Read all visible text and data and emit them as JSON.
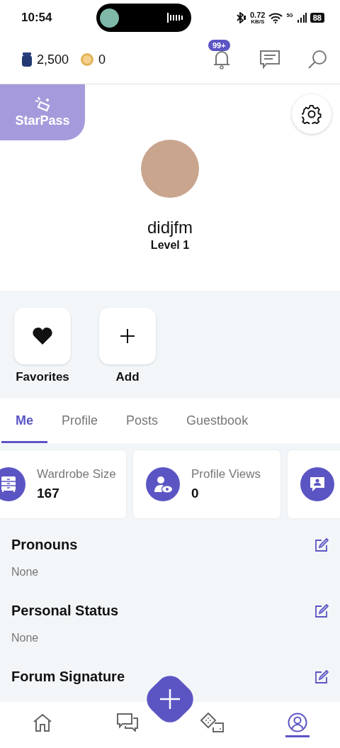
{
  "status_bar": {
    "time": "10:54",
    "speed": "0.72",
    "speed_unit": "KB/S",
    "network": "5G",
    "battery": "88"
  },
  "top_bar": {
    "gems": "2,500",
    "coins": "0",
    "notification_badge": "99+"
  },
  "starpass": {
    "label": "StarPass"
  },
  "profile": {
    "username": "didjfm",
    "level": "Level 1"
  },
  "shortcuts": [
    {
      "kind": "heart",
      "label": "Favorites"
    },
    {
      "kind": "plus",
      "label": "Add"
    }
  ],
  "tabs": [
    {
      "label": "Me",
      "selected": true
    },
    {
      "label": "Profile",
      "selected": false
    },
    {
      "label": "Posts",
      "selected": false
    },
    {
      "label": "Guestbook",
      "selected": false
    }
  ],
  "stats": [
    {
      "kind": "wardrobe",
      "label": "Wardrobe Size",
      "value": "167"
    },
    {
      "kind": "viewer",
      "label": "Profile Views",
      "value": "0"
    },
    {
      "kind": "chat"
    }
  ],
  "fields": [
    {
      "label": "Pronouns",
      "value": "None"
    },
    {
      "label": "Personal Status",
      "value": "None"
    },
    {
      "label": "Forum Signature"
    }
  ],
  "nav": [
    {
      "kind": "home",
      "selected": false
    },
    {
      "kind": "chats",
      "selected": false
    },
    {
      "kind": "dice",
      "selected": false
    },
    {
      "kind": "person",
      "selected": true
    }
  ]
}
